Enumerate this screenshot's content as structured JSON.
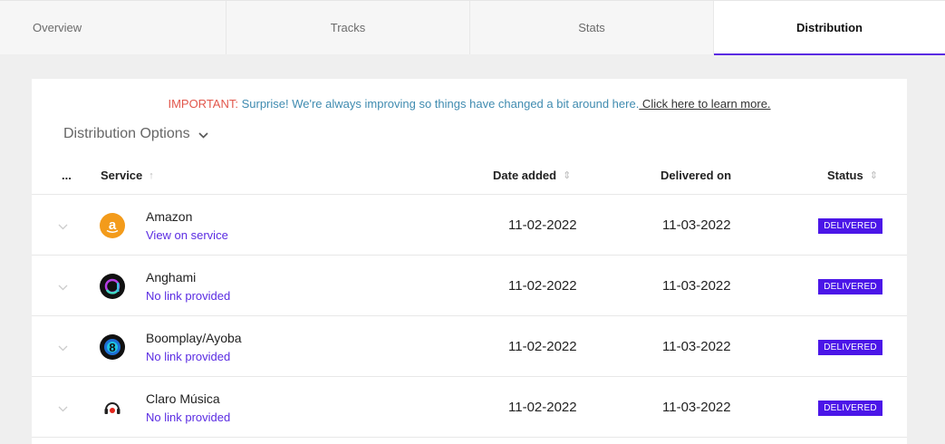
{
  "tabs": [
    {
      "label": "Overview"
    },
    {
      "label": "Tracks"
    },
    {
      "label": "Stats"
    },
    {
      "label": "Distribution",
      "active": true
    }
  ],
  "notice": {
    "important": "IMPORTANT:",
    "message": " Surprise! We're always improving so things have changed a bit around here.",
    "link": " Click here to learn more."
  },
  "distribution_options": {
    "label": "Distribution Options"
  },
  "table": {
    "headers": {
      "more": "...",
      "service": "Service",
      "date_added": "Date added",
      "delivered_on": "Delivered on",
      "status": "Status"
    },
    "rows": [
      {
        "service": "Amazon",
        "link": "View on service",
        "date_added": "11-02-2022",
        "delivered_on": "11-03-2022",
        "status": "DELIVERED",
        "icon": "amazon-icon"
      },
      {
        "service": "Anghami",
        "link": "No link provided",
        "date_added": "11-02-2022",
        "delivered_on": "11-03-2022",
        "status": "DELIVERED",
        "icon": "anghami-icon"
      },
      {
        "service": "Boomplay/Ayoba",
        "link": "No link provided",
        "date_added": "11-02-2022",
        "delivered_on": "11-03-2022",
        "status": "DELIVERED",
        "icon": "boomplay-icon"
      },
      {
        "service": "Claro Música",
        "link": "No link provided",
        "date_added": "11-02-2022",
        "delivered_on": "11-03-2022",
        "status": "DELIVERED",
        "icon": "claro-musica-icon"
      }
    ]
  },
  "colors": {
    "accent": "#5a2be2",
    "badge": "#4b16e8",
    "important": "#e2574c",
    "notice_text": "#3f8bb0"
  }
}
